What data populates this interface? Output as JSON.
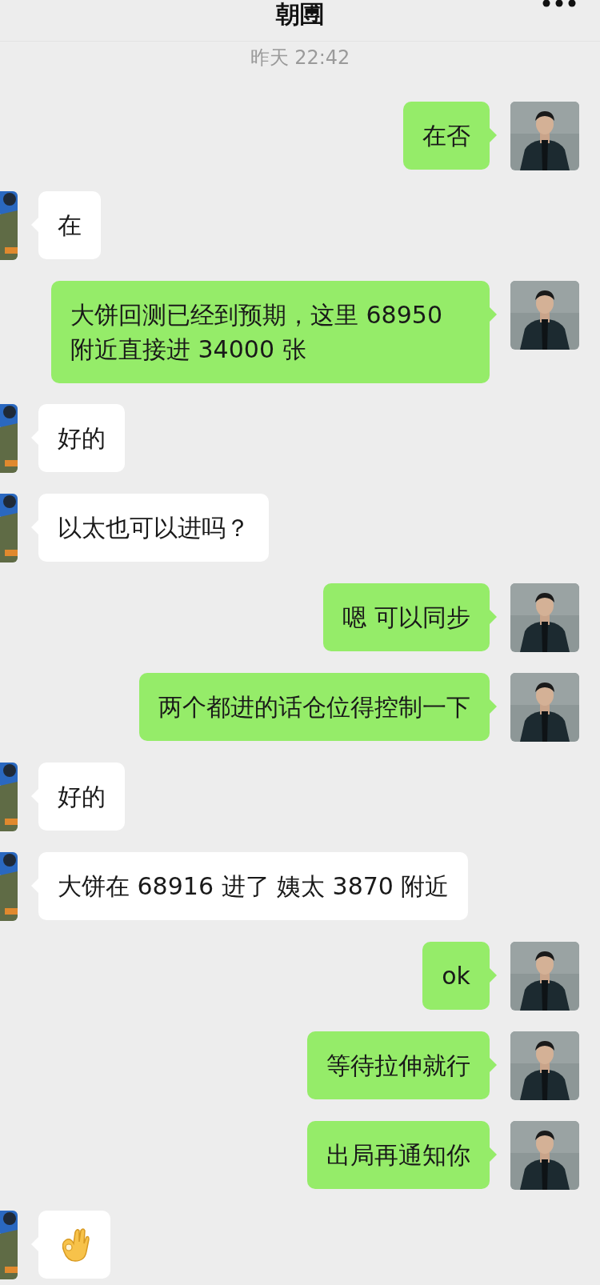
{
  "header": {
    "title": "朝圑"
  },
  "timestamp": "昨天 22:42",
  "messages": [
    {
      "outgoing": true,
      "kind": "text",
      "text": "在否"
    },
    {
      "outgoing": false,
      "kind": "text",
      "text": "在"
    },
    {
      "outgoing": true,
      "kind": "text",
      "text": "大饼回测已经到预期，这里 68950 附近直接进 34000 张"
    },
    {
      "outgoing": false,
      "kind": "text",
      "text": "好的"
    },
    {
      "outgoing": false,
      "kind": "text",
      "text": "以太也可以进吗？"
    },
    {
      "outgoing": true,
      "kind": "text",
      "text": "嗯 可以同步"
    },
    {
      "outgoing": true,
      "kind": "text",
      "text": "两个都进的话仓位得控制一下"
    },
    {
      "outgoing": false,
      "kind": "text",
      "text": "好的"
    },
    {
      "outgoing": false,
      "kind": "text",
      "text": "大饼在 68916 进了 姨太 3870 附近"
    },
    {
      "outgoing": true,
      "kind": "text",
      "text": "ok"
    },
    {
      "outgoing": true,
      "kind": "text",
      "text": "等待拉伸就行"
    },
    {
      "outgoing": true,
      "kind": "text",
      "text": "出局再通知你"
    },
    {
      "outgoing": false,
      "kind": "emoji"
    }
  ]
}
